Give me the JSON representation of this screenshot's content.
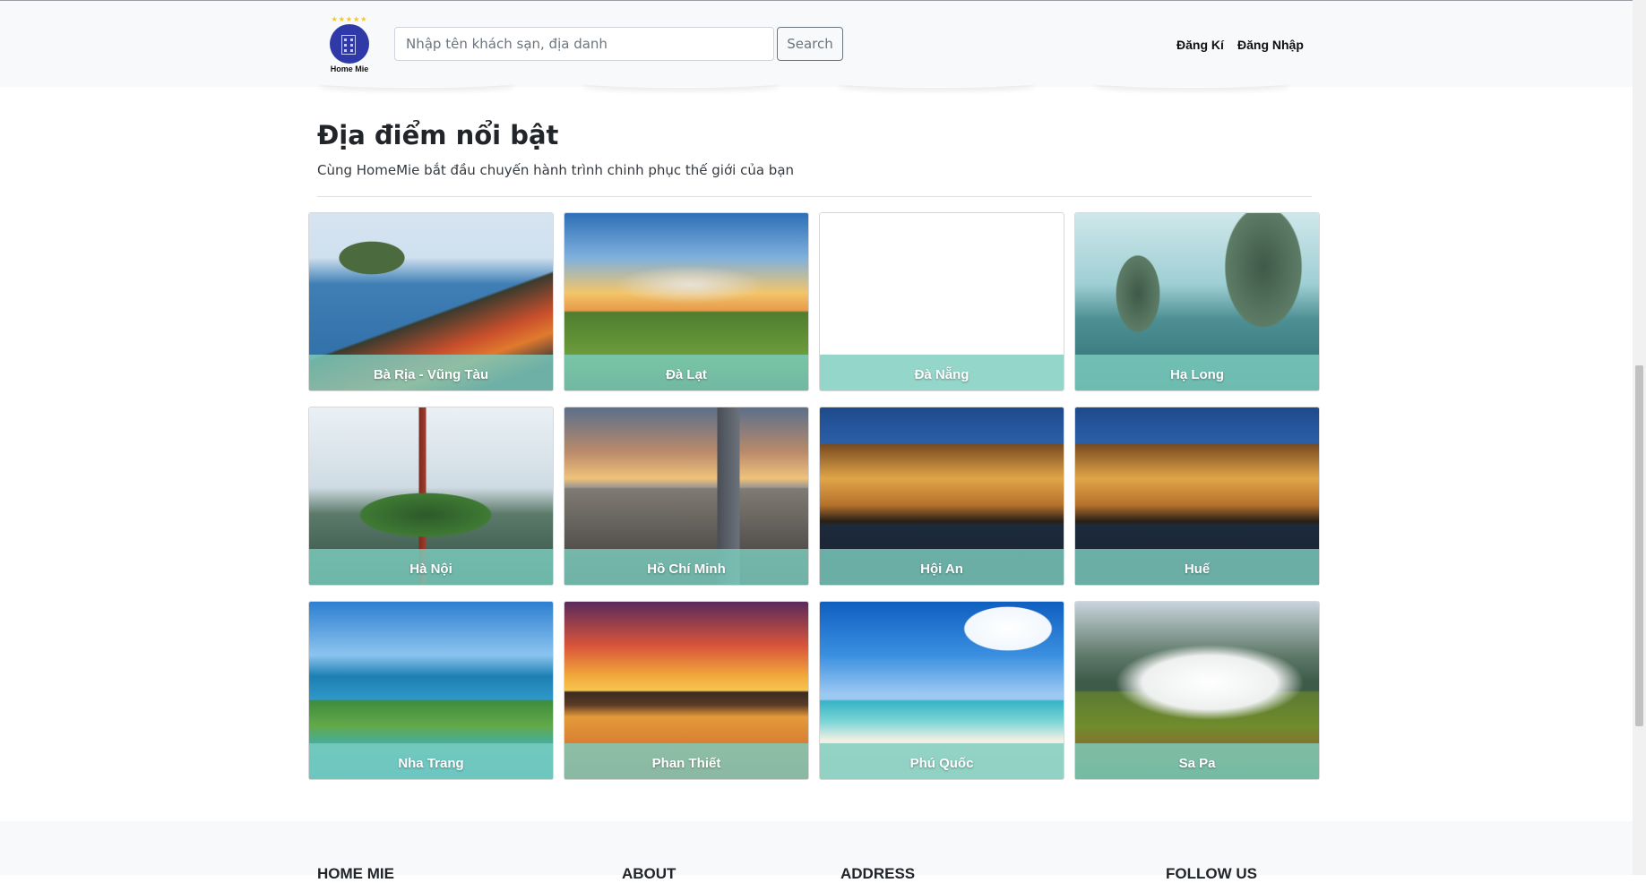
{
  "header": {
    "logo_text": "Home Mie",
    "logo_stars": "★★★★★",
    "search_placeholder": "Nhập tên khách sạn, địa danh",
    "search_button": "Search",
    "nav": {
      "register": "Đăng Kí",
      "login": "Đăng Nhập"
    }
  },
  "section": {
    "title": "Địa điểm nổi bật",
    "subtitle": "Cùng HomeMie bắt đầu chuyến hành trình chinh phục thế giới của bạn"
  },
  "destinations": [
    {
      "label": "Bà Rịa - Vũng Tàu"
    },
    {
      "label": "Đà Lạt"
    },
    {
      "label": "Đà Nẵng"
    },
    {
      "label": "Hạ Long"
    },
    {
      "label": "Hà Nội"
    },
    {
      "label": "Hồ Chí Minh"
    },
    {
      "label": "Hội An"
    },
    {
      "label": "Huế"
    },
    {
      "label": "Nha Trang"
    },
    {
      "label": "Phan Thiết"
    },
    {
      "label": "Phú Quốc"
    },
    {
      "label": "Sa Pa"
    }
  ],
  "footer": {
    "headings": [
      "HOME MIE",
      "ABOUT",
      "ADDRESS",
      "FOLLOW US"
    ]
  },
  "colors": {
    "caption_overlay": "#7dcdbe",
    "header_bg": "#f8f9fa",
    "logo_circle": "#2f3aa8"
  }
}
